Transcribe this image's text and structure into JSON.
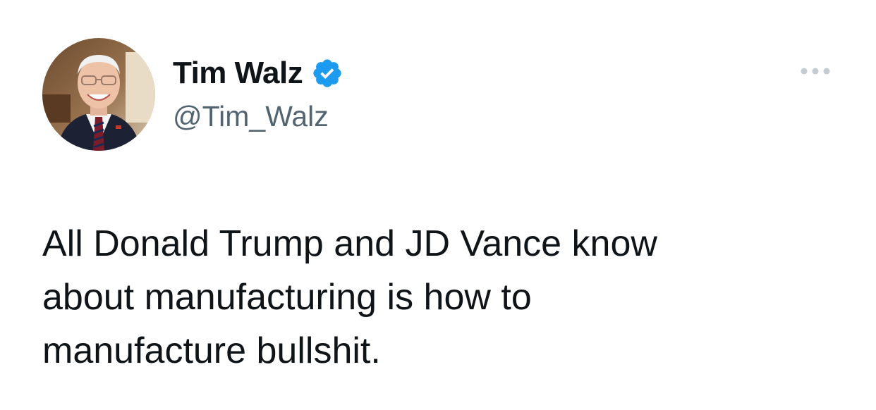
{
  "author": {
    "display_name": "Tim Walz",
    "handle": "@Tim_Walz",
    "verified": true,
    "verified_color": "#1d9bf0"
  },
  "tweet": {
    "text": "All Donald Trump and JD Vance know\nabout manufacturing is how to\nmanufacture bullshit."
  },
  "icons": {
    "verified": "verified-badge-icon",
    "more": "more-options-icon"
  }
}
